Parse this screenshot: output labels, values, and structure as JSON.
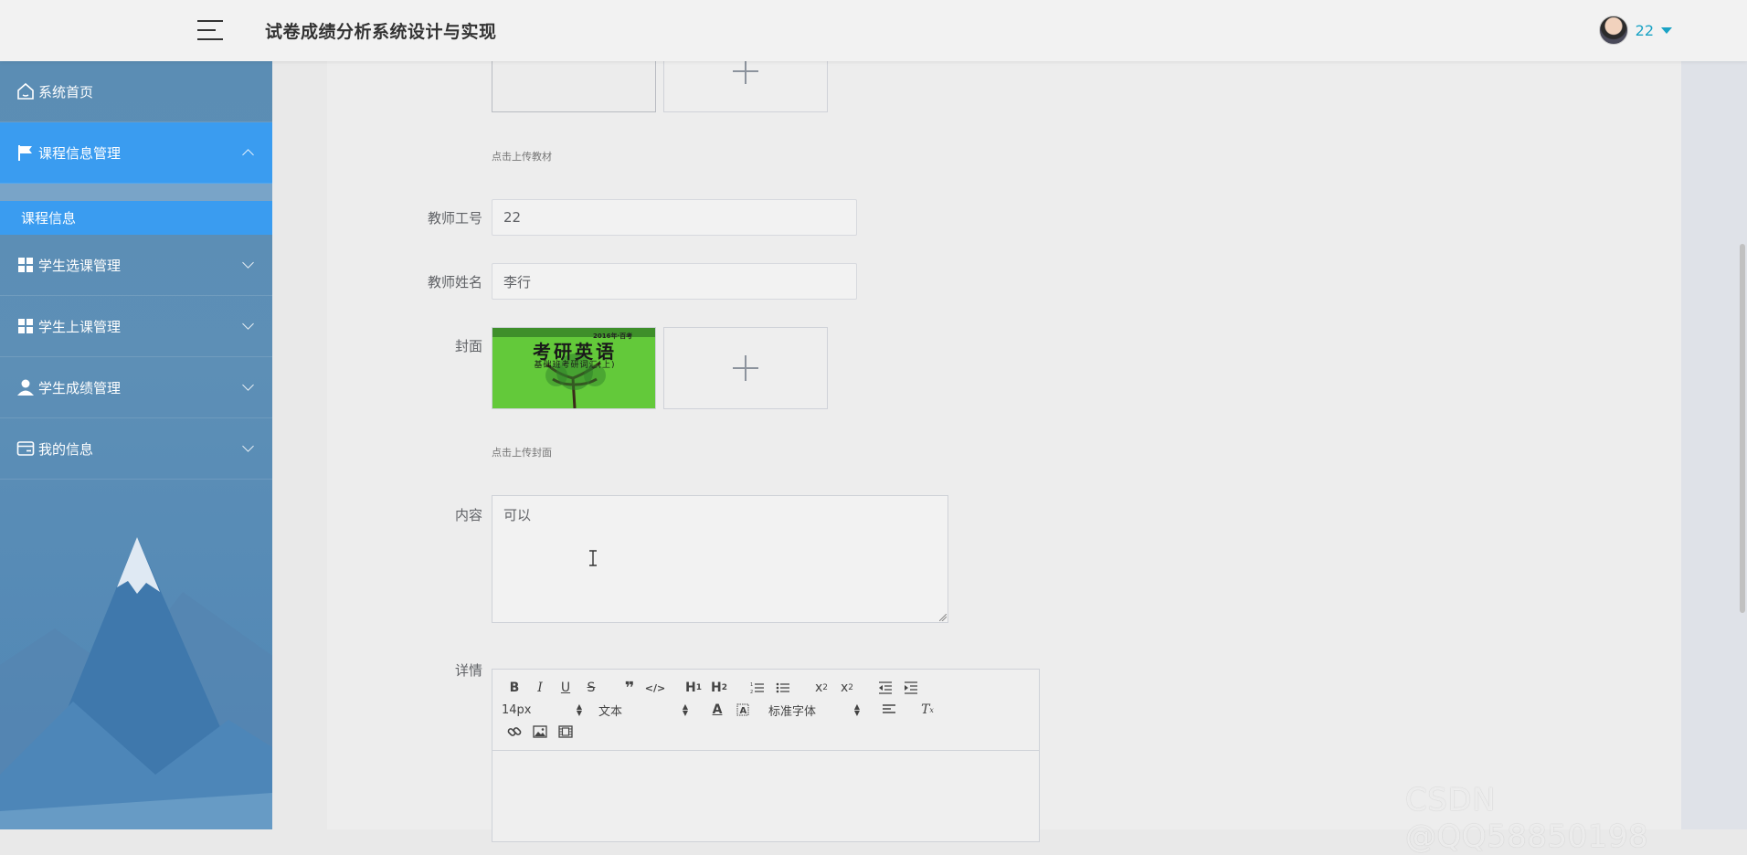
{
  "header": {
    "app_title": "试卷成绩分析系统设计与实现",
    "user_name": "22"
  },
  "sidebar": {
    "items": [
      {
        "label": "系统首页",
        "icon": "home-icon"
      },
      {
        "label": "课程信息管理",
        "icon": "flag-icon",
        "expanded": true
      },
      {
        "label": "学生选课管理",
        "icon": "grid-icon"
      },
      {
        "label": "学生上课管理",
        "icon": "grid-icon"
      },
      {
        "label": "学生成绩管理",
        "icon": "user-icon"
      },
      {
        "label": "我的信息",
        "icon": "card-icon"
      }
    ],
    "subitems": [
      {
        "label": "课程信息"
      }
    ]
  },
  "form": {
    "material_hint": "点击上传教材",
    "teacher_id_label": "教师工号",
    "teacher_id_value": "22",
    "teacher_name_label": "教师姓名",
    "teacher_name_value": "李行",
    "cover_label": "封面",
    "cover_hint": "点击上传封面",
    "cover_image_text": {
      "line1": "2016年·百考",
      "line2": "考研英语",
      "line3": "基础班考研词汇(上)"
    },
    "content_label": "内容",
    "content_value": "可以",
    "detail_label": "详情"
  },
  "editor": {
    "font_size": "14px",
    "block_type": "文本",
    "font_family": "标准字体"
  },
  "watermark": "CSDN @QQ58850198",
  "colors": {
    "accent": "#3a9cf0",
    "sidebar_bg": "#5b8db4",
    "user_link": "#1aa3c5"
  }
}
